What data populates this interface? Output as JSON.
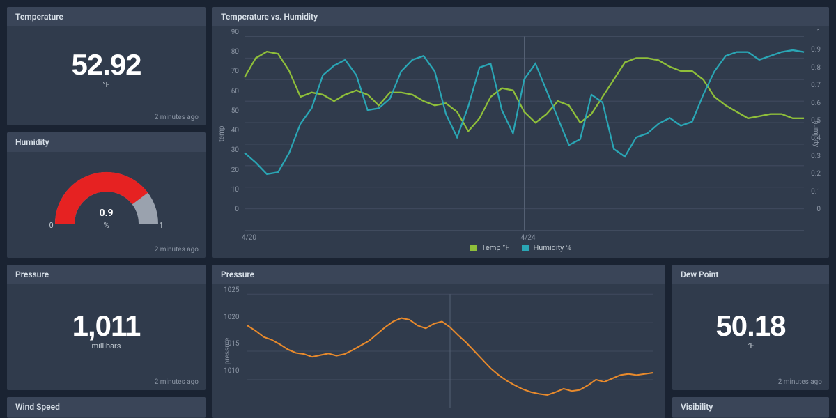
{
  "tiles": {
    "temperature": {
      "title": "Temperature",
      "value": "52.92",
      "unit": "°F",
      "age": "2 minutes ago"
    },
    "humidity": {
      "title": "Humidity",
      "value": "0.9",
      "unit": "%",
      "min": "0",
      "max": "1",
      "age": "2 minutes ago"
    },
    "pressure": {
      "title": "Pressure",
      "value": "1,011",
      "unit": "millibars",
      "age": "2 minutes ago"
    },
    "dewpoint": {
      "title": "Dew Point",
      "value": "50.18",
      "unit": "°F",
      "age": "2 minutes ago"
    },
    "windspeed": {
      "title": "Wind Speed"
    },
    "visibility": {
      "title": "Visibility"
    }
  },
  "th_chart": {
    "title": "Temperature vs. Humidity",
    "left_label": "temp",
    "right_label": "humidity",
    "xtick1": "4/20",
    "xtick2": "4/24",
    "legend_temp": "Temp °F",
    "legend_hum": "Humidity %"
  },
  "p_chart": {
    "title": "Pressure",
    "ylabel": "pressure"
  },
  "chart_data": [
    {
      "type": "line",
      "title": "Temperature vs. Humidity",
      "xlabel": "",
      "x_ticks": [
        "4/20",
        "4/24"
      ],
      "series": [
        {
          "name": "Temp °F",
          "axis": "left",
          "ylabel": "temp",
          "ylim": [
            0,
            90
          ],
          "yticks": [
            0,
            10,
            20,
            30,
            40,
            50,
            60,
            70,
            80,
            90
          ],
          "color": "#8fbf3a",
          "values": [
            71,
            80,
            83,
            82,
            74,
            62,
            64,
            63,
            60,
            63,
            65,
            63,
            58,
            64,
            64,
            63,
            60,
            58,
            59,
            55,
            46,
            52,
            62,
            66,
            65,
            55,
            50,
            54,
            60,
            58,
            50,
            54,
            62,
            70,
            78,
            80,
            80,
            79,
            76,
            74,
            74,
            70,
            62,
            58,
            55,
            52,
            53,
            54,
            54,
            52,
            52
          ]
        },
        {
          "name": "Humidity %",
          "axis": "right",
          "ylabel": "humidity",
          "ylim": [
            0,
            1
          ],
          "yticks": [
            0,
            0.1,
            0.2,
            0.3,
            0.4,
            0.5,
            0.6,
            0.7,
            0.8,
            0.9,
            1
          ],
          "color": "#2aa6b5",
          "values": [
            0.4,
            0.35,
            0.29,
            0.3,
            0.4,
            0.55,
            0.63,
            0.8,
            0.85,
            0.88,
            0.8,
            0.62,
            0.63,
            0.68,
            0.82,
            0.88,
            0.9,
            0.82,
            0.6,
            0.48,
            0.64,
            0.84,
            0.86,
            0.62,
            0.5,
            0.78,
            0.86,
            0.72,
            0.58,
            0.44,
            0.47,
            0.7,
            0.66,
            0.42,
            0.38,
            0.48,
            0.5,
            0.55,
            0.58,
            0.54,
            0.56,
            0.7,
            0.82,
            0.9,
            0.92,
            0.92,
            0.88,
            0.9,
            0.92,
            0.93,
            0.92
          ]
        }
      ]
    },
    {
      "type": "line",
      "title": "Pressure",
      "ylabel": "pressure",
      "ylim": [
        1005,
        1025
      ],
      "yticks": [
        1010,
        1015,
        1020,
        1025
      ],
      "color": "#e88a2c",
      "values": [
        1019.5,
        1018.6,
        1017.5,
        1017.0,
        1016.2,
        1015.3,
        1014.7,
        1014.5,
        1014.0,
        1014.3,
        1014.6,
        1014.2,
        1014.5,
        1015.2,
        1016.0,
        1016.8,
        1018.0,
        1019.2,
        1020.2,
        1020.8,
        1020.5,
        1019.5,
        1019.0,
        1019.8,
        1020.2,
        1019.2,
        1017.8,
        1016.5,
        1015.0,
        1013.5,
        1012.0,
        1010.8,
        1009.8,
        1009.0,
        1008.3,
        1007.8,
        1007.5,
        1007.3,
        1007.8,
        1008.4,
        1008.0,
        1008.2,
        1009.0,
        1010.0,
        1009.6,
        1010.2,
        1010.8,
        1011.0,
        1010.8,
        1011.0,
        1011.2
      ]
    }
  ]
}
